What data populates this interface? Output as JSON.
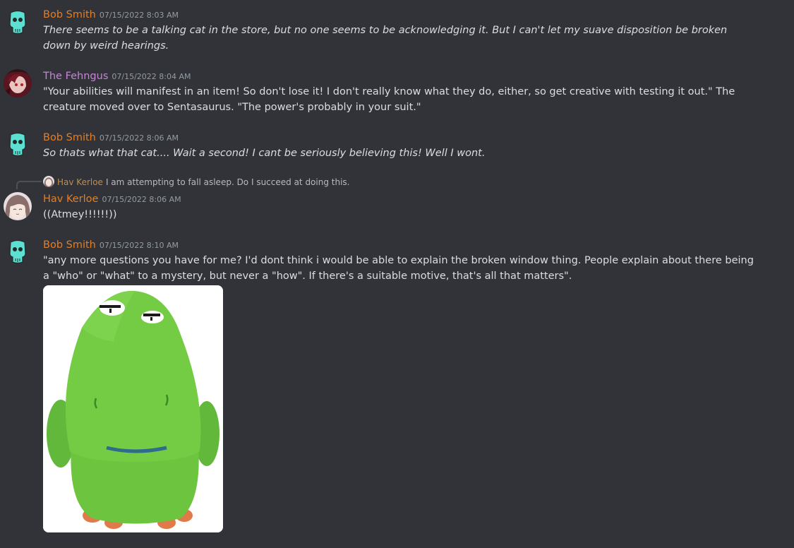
{
  "colors": {
    "background": "#313338",
    "text": "#dbdee1",
    "timestamp": "#949ba4",
    "bob_name": "#e67e22",
    "fehngus_name": "#c686d6",
    "hav_name": "#e67e22"
  },
  "messages": [
    {
      "author": "Bob Smith",
      "timestamp": "07/15/2022 8:03 AM",
      "avatar_icon": "teal-skull-avatar",
      "text": "There seems to be a talking cat in the store, but no one seems to be acknowledging it. But I can't let my suave disposition be broken down by weird hearings."
    },
    {
      "author": "The Fehngus",
      "timestamp": "07/15/2022 8:04 AM",
      "avatar_icon": "red-anime-avatar",
      "text": "\"Your abilities will manifest in an item! So don't lose it! I don't really know what they do, either, so get creative with testing it out.\" The creature moved over to Sentasaurus. \"The power's probably in your suit.\""
    },
    {
      "author": "Bob Smith",
      "timestamp": "07/15/2022 8:06 AM",
      "avatar_icon": "teal-skull-avatar",
      "text": "So thats what that cat.... Wait a second! I cant be seriously believing this! Well I wont."
    },
    {
      "author": "Hav Kerloe",
      "timestamp": "07/15/2022 8:06 AM",
      "avatar_icon": "anime-girl-avatar",
      "reply": {
        "author": "Hav Kerloe",
        "text": "I am attempting to fall asleep. Do I succeed at doing this."
      },
      "text": "((Atmey!!!!!!))"
    },
    {
      "author": "Bob Smith",
      "timestamp": "07/15/2022 8:10 AM",
      "avatar_icon": "teal-skull-avatar",
      "text": "\"any more questions you have for me? I'd dont think i would be able to explain the broken window thing. People explain about there being a \"who\" or \"what\" to a mystery, but never a \"how\". If there's a suitable motive, that's all that matters\".",
      "attachment": "green-dinosaur-plush-image"
    }
  ]
}
